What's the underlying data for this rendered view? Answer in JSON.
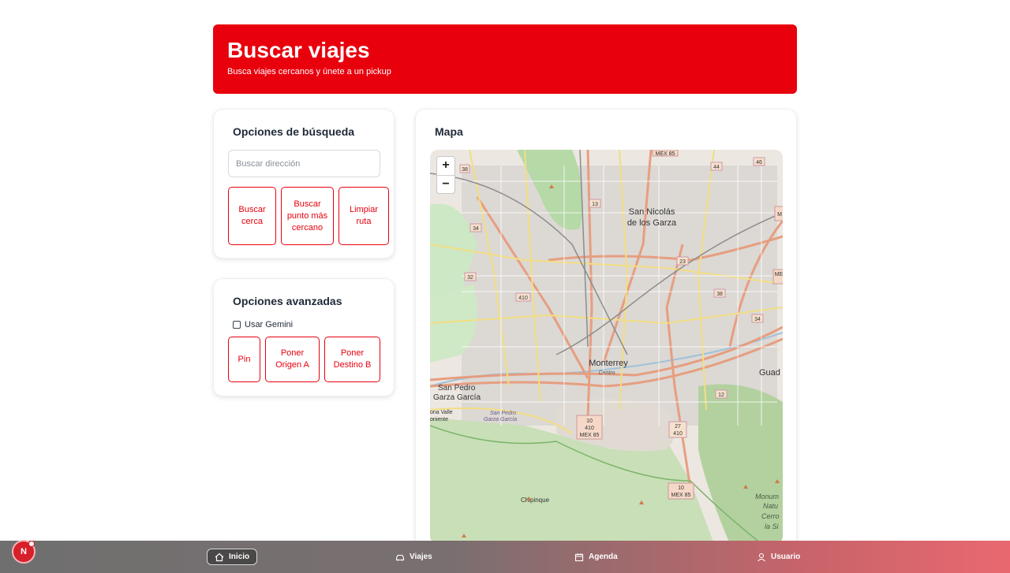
{
  "header": {
    "title": "Buscar viajes",
    "subtitle": "Busca viajes cercanos y únete a un pickup",
    "bg_color": "#e8000d"
  },
  "search_options": {
    "title": "Opciones de búsqueda",
    "address_placeholder": "Buscar dirección",
    "buttons": {
      "search_near": "Buscar cerca",
      "nearest_point": "Buscar punto más cercano",
      "clear_route": "Limpiar ruta"
    }
  },
  "advanced_options": {
    "title": "Opciones avanzadas",
    "use_gemini_label": "Usar Gemini",
    "use_gemini_checked": false,
    "buttons": {
      "pin": "Pin",
      "set_origin": "Poner Origen A",
      "set_destination": "Poner Destino B"
    }
  },
  "map": {
    "title": "Mapa",
    "zoom_in": "+",
    "zoom_out": "−",
    "labels": {
      "san_nicolas_1": "San Nicolás",
      "san_nicolas_2": "de los Garza",
      "monterrey": "Monterrey",
      "centro": "Centro",
      "san_pedro_1": "San Pedro",
      "san_pedro_2": "Garza García",
      "san_pedro_small_1": "San Pedro",
      "san_pedro_small_2": "Garza García",
      "valle_1": "ona Valle",
      "valle_2": "oniente",
      "chipinque": "Chipinque",
      "guadalupe": "Guad",
      "monumento_1": "Monum",
      "monumento_2": "Natu",
      "monumento_3": "Cerro",
      "monumento_4": "la Si"
    },
    "shields": [
      "MEX 85",
      "38",
      "44",
      "46",
      "13",
      "34",
      "32",
      "410",
      "23",
      "38",
      "34",
      "12",
      "10",
      "410",
      "MEX 85",
      "27",
      "410",
      "10",
      "MEX 85",
      "M",
      "ME"
    ]
  },
  "nav": {
    "items": [
      {
        "label": "Inicio",
        "icon": "home-icon",
        "active": true
      },
      {
        "label": "Viajes",
        "icon": "car-icon",
        "active": false
      },
      {
        "label": "Agenda",
        "icon": "calendar-icon",
        "active": false
      },
      {
        "label": "Usuario",
        "icon": "user-icon",
        "active": false
      }
    ],
    "badge": "N"
  }
}
